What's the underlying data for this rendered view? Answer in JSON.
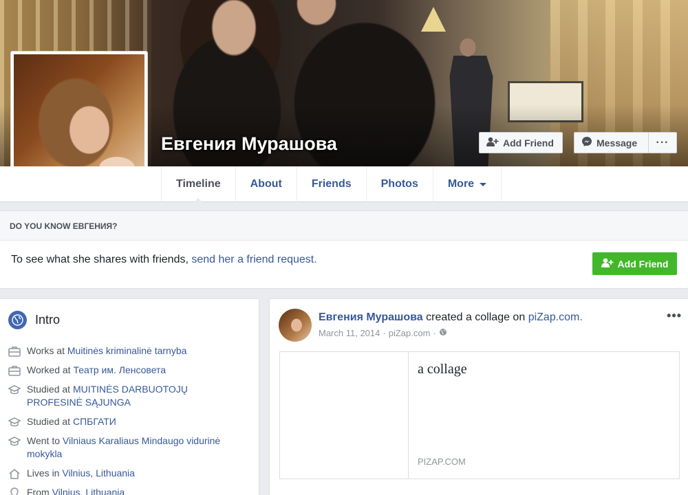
{
  "profile": {
    "name": "Евгения Мурашова"
  },
  "cover_buttons": {
    "add_friend": "Add Friend",
    "message": "Message",
    "more": "···"
  },
  "tabs": [
    {
      "label": "Timeline"
    },
    {
      "label": "About"
    },
    {
      "label": "Friends"
    },
    {
      "label": "Photos"
    },
    {
      "label": "More"
    }
  ],
  "know_box": {
    "heading": "DO YOU KNOW ЕВГЕНИЯ?",
    "text": "To see what she shares with friends,",
    "link": "send her a friend request.",
    "button": "Add Friend"
  },
  "intro": {
    "title": "Intro",
    "items": [
      {
        "icon": "briefcase-icon",
        "prefix": "Works at",
        "link": "Muitinės kriminalinė tarnyba"
      },
      {
        "icon": "briefcase-icon",
        "prefix": "Worked at",
        "link": "Театр им. Ленсовета"
      },
      {
        "icon": "graduation-cap-icon",
        "prefix": "Studied at",
        "link": "MUITINĖS DARBUOTOJŲ PROFESINĖ SĄJUNGA"
      },
      {
        "icon": "graduation-cap-icon",
        "prefix": "Studied at",
        "link": "СПБГАТИ"
      },
      {
        "icon": "graduation-cap-icon",
        "prefix": "Went to",
        "link": "Vilniaus Karaliaus Mindaugo vidurinė mokykla"
      },
      {
        "icon": "home-icon",
        "prefix": "Lives in",
        "link": "Vilnius, Lithuania"
      },
      {
        "icon": "location-icon",
        "prefix": "From",
        "link": "Vilnius, Lithuania"
      }
    ]
  },
  "post": {
    "author": "Евгения Мурашова",
    "action": "created a collage on",
    "site": "piZap.com.",
    "date": "March 11, 2014",
    "via": "piZap.com",
    "dot": "·",
    "menu": "•••",
    "card_title": "a collage",
    "card_source": "PIZAP.COM"
  }
}
